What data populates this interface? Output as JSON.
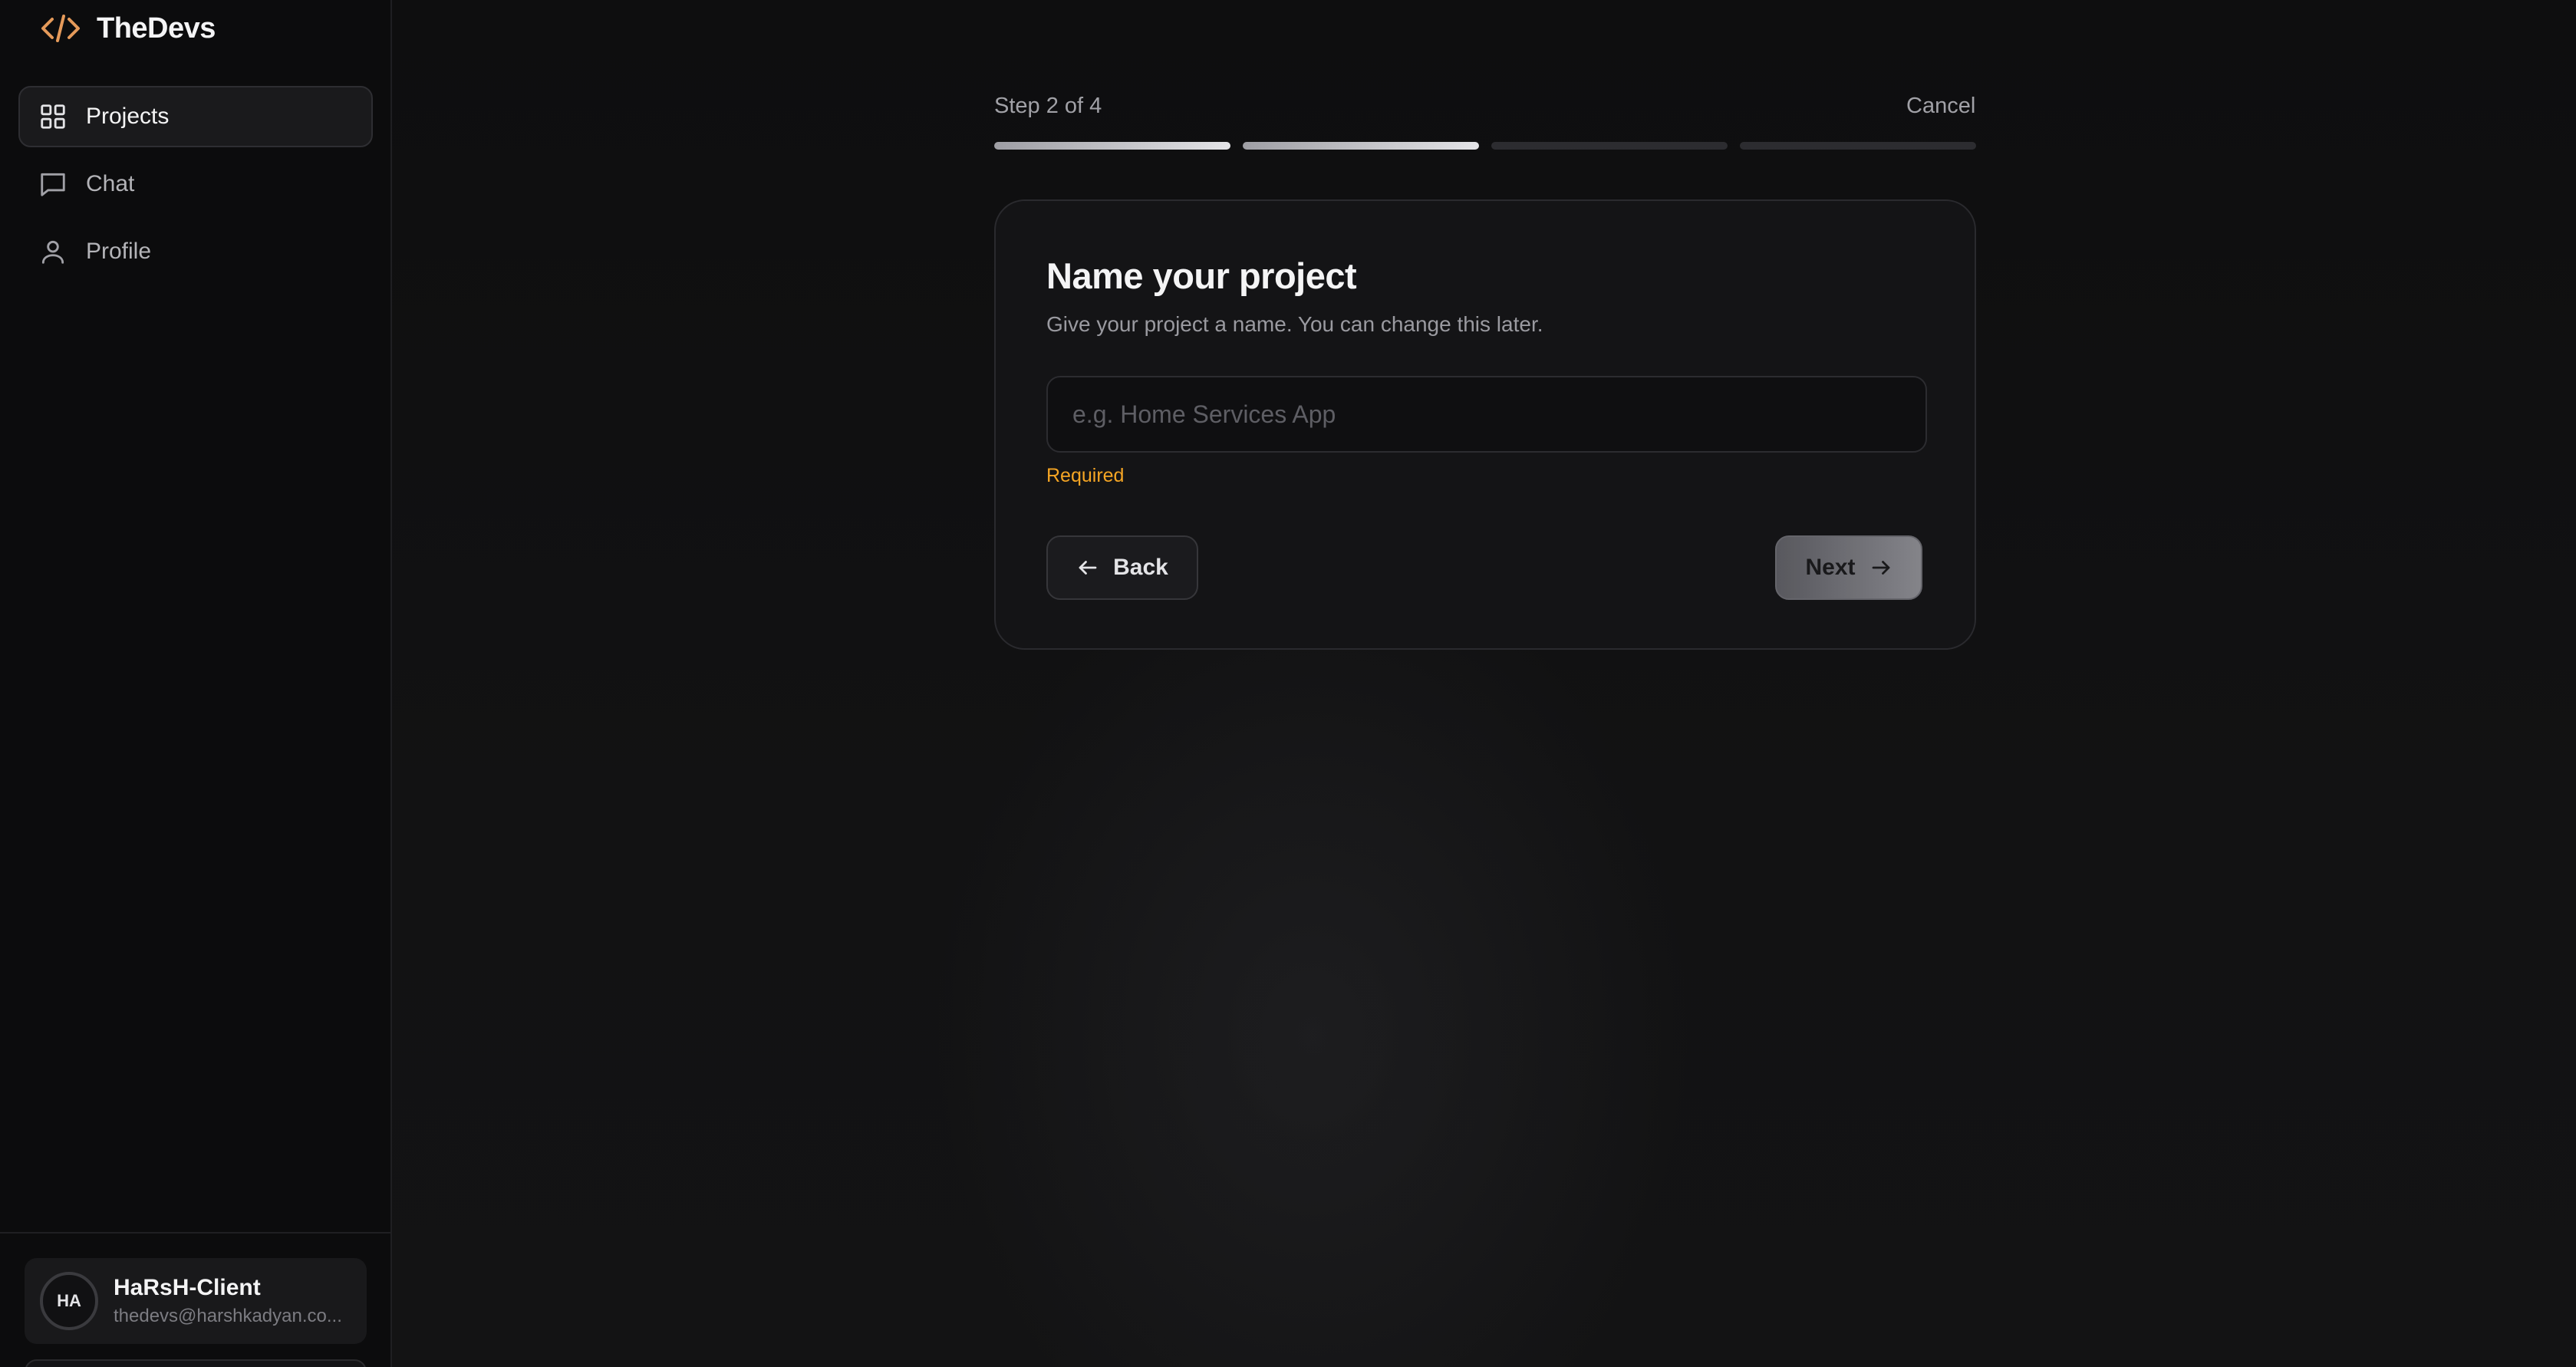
{
  "app": {
    "brand_name": "TheDevs",
    "brand_color": "#e59a5a"
  },
  "sidebar": {
    "items": [
      {
        "label": "Projects",
        "icon": "grid-icon",
        "active": true
      },
      {
        "label": "Chat",
        "icon": "chat-bubble-icon",
        "active": false
      },
      {
        "label": "Profile",
        "icon": "user-icon",
        "active": false
      }
    ],
    "user": {
      "initials": "HA",
      "name": "HaRsH-Client",
      "email": "thedevs@harshkadyan.co..."
    }
  },
  "wizard": {
    "step_label": "Step 2 of 4",
    "current_step": 2,
    "total_steps": 4,
    "cancel_label": "Cancel",
    "title": "Name your project",
    "subtitle": "Give your project a name. You can change this later.",
    "input": {
      "value": "",
      "placeholder": "e.g. Home Services App"
    },
    "validation_message": "Required",
    "validation_color": "#f5a524",
    "back_label": "Back",
    "next_label": "Next"
  }
}
